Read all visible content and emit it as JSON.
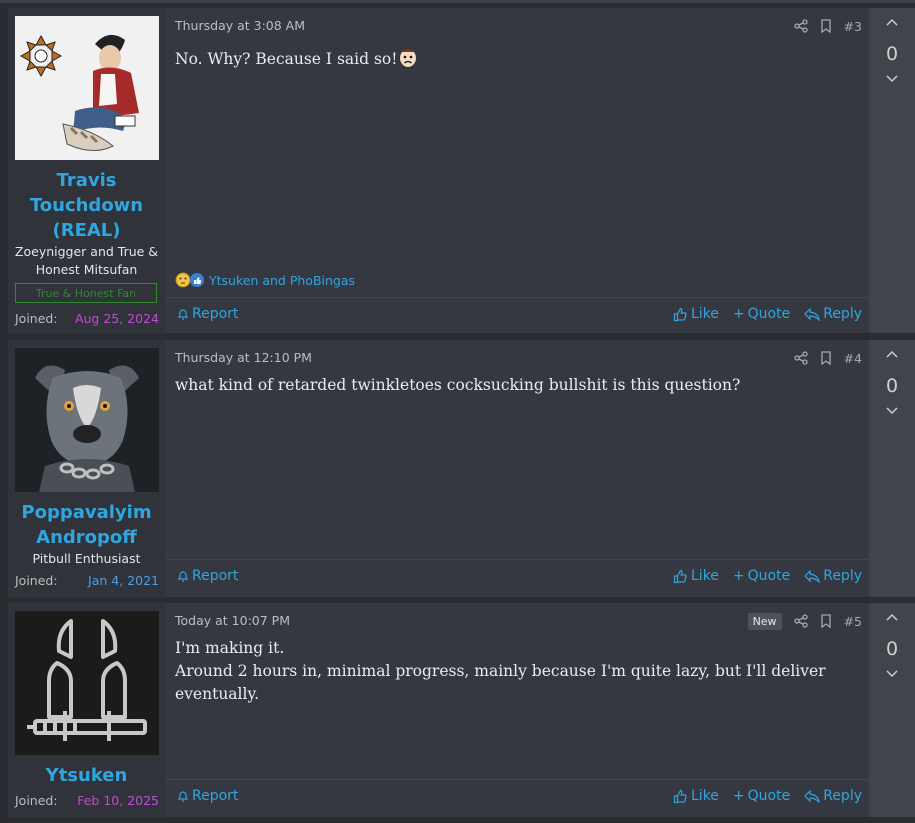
{
  "posts": [
    {
      "id": "post3",
      "username": "Travis Touchdown (REAL)",
      "user_title": "Zoeynigger and True & Honest Mitsufan",
      "user_banner": "True & Honest Fan",
      "joined_label": "Joined:",
      "joined_date": "Aug 25, 2024",
      "date": "Thursday at 3:08 AM",
      "number": "#3",
      "message": [
        "No. Why? Because I said so!"
      ],
      "reactions": "Ytsuken and PhoBingas",
      "score": "0"
    },
    {
      "id": "post4",
      "username": "Poppavalyim Andropoff",
      "user_title": "Pitbull Enthusiast",
      "joined_label": "Joined:",
      "joined_date": "Jan 4, 2021",
      "date": "Thursday at 12:10 PM",
      "number": "#4",
      "message": [
        "what kind of retarded twinkletoes cocksucking bullshit is this question?"
      ],
      "score": "0"
    },
    {
      "id": "post5",
      "username": "Ytsuken",
      "joined_label": "Joined:",
      "joined_date": "Feb 10, 2025",
      "date": "Today at 10:07 PM",
      "badge": "New",
      "number": "#5",
      "message": [
        "I'm making it.",
        "Around 2 hours in, minimal progress, mainly because I'm quite lazy, but I'll deliver eventually."
      ],
      "score": "0"
    }
  ],
  "actions": {
    "report": "Report",
    "like": "Like",
    "quote": "Quote",
    "reply": "Reply"
  },
  "colors": {
    "accent": "#2fa6df",
    "joined_purple": "#c24ad6",
    "joined_blue": "#4b9fe0",
    "banner_green": "#2d8a2d"
  }
}
